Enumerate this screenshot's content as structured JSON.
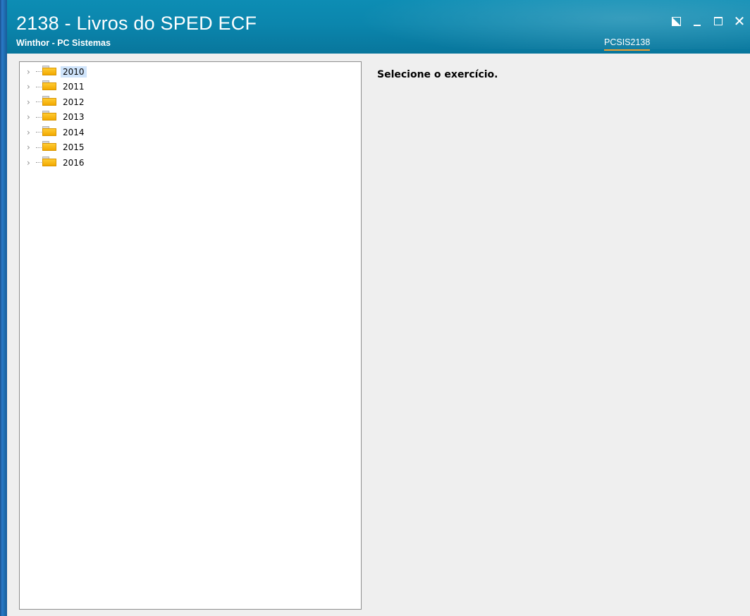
{
  "window": {
    "title": "2138 - Livros do SPED ECF",
    "subtitle": "Winthor - PC Sistemas",
    "routine_code": "PCSIS2138",
    "controls": [
      {
        "name": "restore-icon",
        "symbol": ""
      },
      {
        "name": "minimize-icon",
        "symbol": ""
      },
      {
        "name": "maximize-icon",
        "symbol": ""
      },
      {
        "name": "close-icon",
        "symbol": "✕"
      }
    ]
  },
  "tree": {
    "nodes": [
      {
        "label": "2010",
        "selected": true
      },
      {
        "label": "2011"
      },
      {
        "label": "2012"
      },
      {
        "label": "2013"
      },
      {
        "label": "2014"
      },
      {
        "label": "2015"
      },
      {
        "label": "2016"
      }
    ],
    "expander_glyph": "›"
  },
  "detail": {
    "message": "Selecione o exercício."
  },
  "colors": {
    "titlebar": "#0b86ad",
    "selection": "#cfe4fb",
    "folder": "#f7bb1a",
    "tab_underline": "#f0a030"
  }
}
